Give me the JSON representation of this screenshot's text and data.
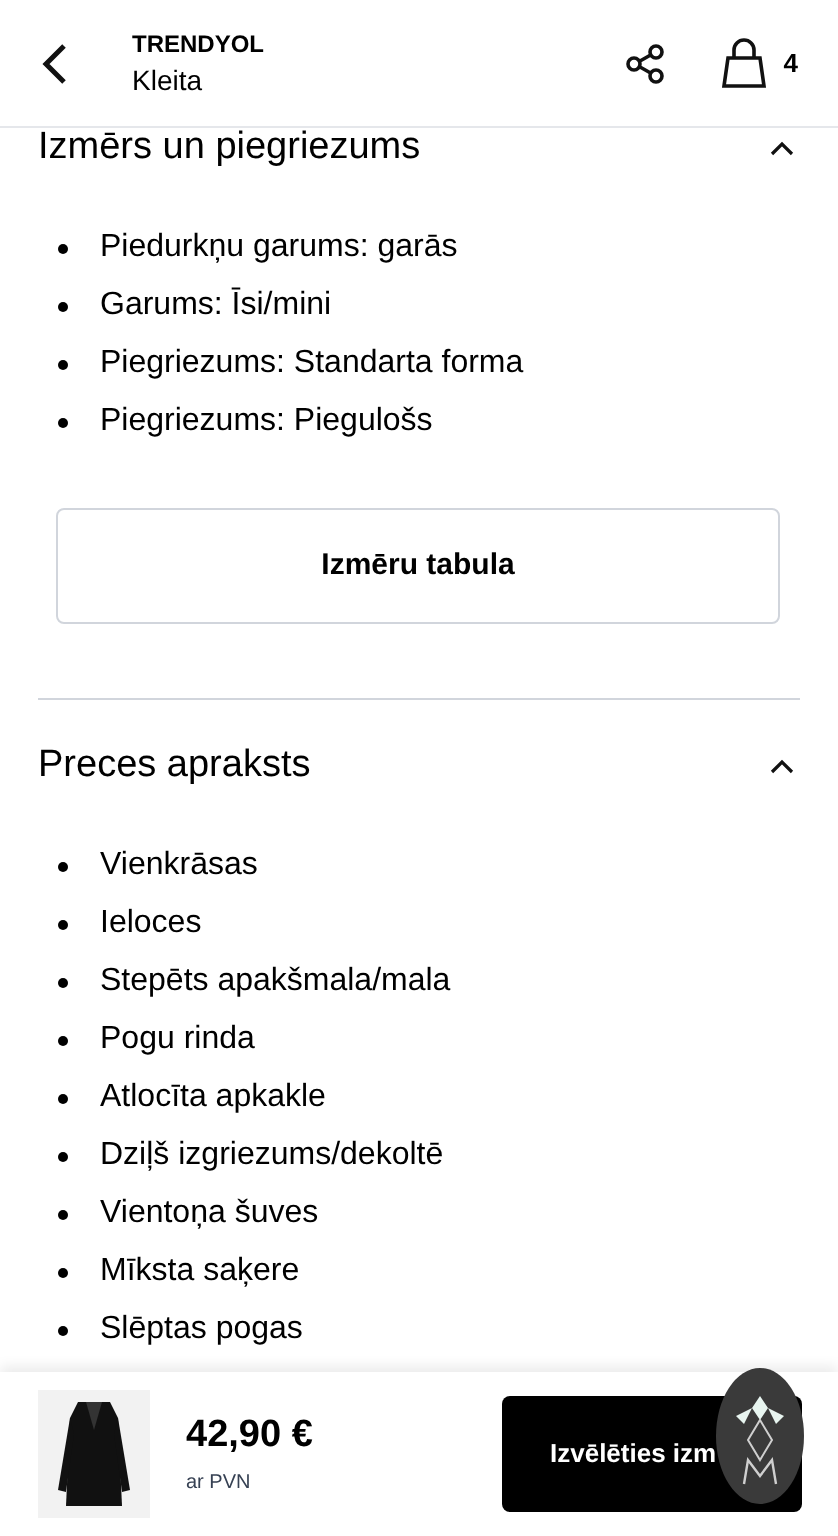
{
  "header": {
    "brand": "TRENDYOL",
    "title": "Kleita",
    "cart_count": "4"
  },
  "sections": [
    {
      "title": "Izmērs un piegriezums",
      "expanded": true,
      "items": [
        "Piedurkņu garums: garās",
        "Garums: Īsi/mini",
        "Piegriezums: Standarta forma",
        "Piegriezums: Piegulošs"
      ],
      "button": "Izmēru tabula"
    },
    {
      "title": "Preces apraksts",
      "expanded": true,
      "items": [
        "Vienkrāsas",
        "Ieloces",
        "Stepēts apakšmala/mala",
        "Pogu rinda",
        "Atlocīta apkakle",
        "Dziļš izgriezums/dekoltē",
        "Vientoņa šuves",
        "Mīksta saķere",
        "Slēptas pogas"
      ]
    }
  ],
  "bottom_bar": {
    "price": "42,90 €",
    "price_note": "ar PVN",
    "button": "Izvēlēties izm"
  }
}
